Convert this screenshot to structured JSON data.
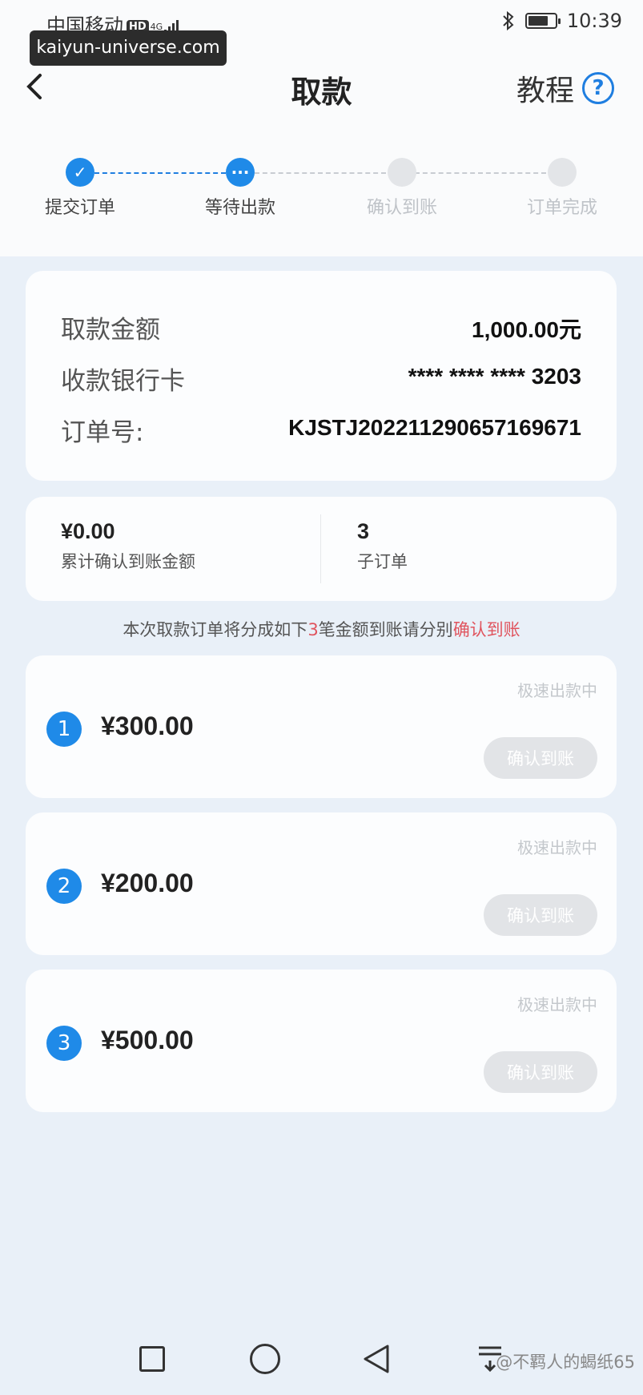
{
  "status_bar": {
    "carrier": "中国移动",
    "hd": "HD",
    "network": "4G",
    "time": "10:39"
  },
  "watermark": "kaiyun-universe.com",
  "header": {
    "title": "取款",
    "tutorial_label": "教程",
    "help_symbol": "?"
  },
  "steps": [
    {
      "label": "提交订单",
      "state": "done",
      "symbol": "✓"
    },
    {
      "label": "等待出款",
      "state": "current",
      "symbol": "···"
    },
    {
      "label": "确认到账",
      "state": "pending",
      "symbol": ""
    },
    {
      "label": "订单完成",
      "state": "pending",
      "symbol": ""
    }
  ],
  "summary": {
    "amount_label": "取款金额",
    "amount_value": "1,000.00元",
    "card_label": "收款银行卡",
    "card_value": "**** **** **** 3203",
    "order_label": "订单号:",
    "order_value": "KJSTJ2022112906571696​71"
  },
  "stats": {
    "confirmed_amount": "¥0.00",
    "confirmed_label": "累计确认到账金额",
    "sub_order_count": "3",
    "sub_order_label": "子订单"
  },
  "notice": {
    "prefix": "本次取款订单将分成如下",
    "count": "3",
    "middle": "笔金额到账请分别",
    "action": "确认到账"
  },
  "sub_orders": [
    {
      "index": "1",
      "amount": "¥300.00",
      "status": "极速出款中",
      "button": "确认到账"
    },
    {
      "index": "2",
      "amount": "¥200.00",
      "status": "极速出款中",
      "button": "确认到账"
    },
    {
      "index": "3",
      "amount": "¥500.00",
      "status": "极速出款中",
      "button": "确认到账"
    }
  ],
  "corner_watermark": "@不羁人的蝎纸65",
  "colors": {
    "accent": "#1f8ae8",
    "highlight_red": "#e0545e",
    "disabled_button": "#e2e4e7",
    "background": "#e9f0f8"
  }
}
